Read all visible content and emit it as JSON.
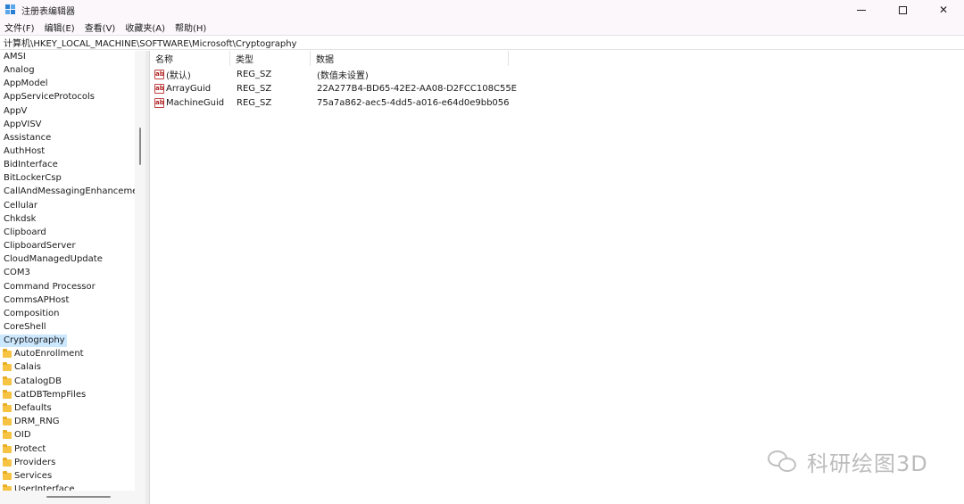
{
  "window": {
    "title": "注册表编辑器",
    "controls": {
      "minimize": "",
      "maximize": "",
      "close": "✕"
    }
  },
  "menu": [
    "文件(F)",
    "编辑(E)",
    "查看(V)",
    "收藏夹(A)",
    "帮助(H)"
  ],
  "address": "计算机\\HKEY_LOCAL_MACHINE\\SOFTWARE\\Microsoft\\Cryptography",
  "tree": {
    "items": [
      {
        "label": "AMSI"
      },
      {
        "label": "Analog"
      },
      {
        "label": "AppModel"
      },
      {
        "label": "AppServiceProtocols"
      },
      {
        "label": "AppV"
      },
      {
        "label": "AppVISV"
      },
      {
        "label": "Assistance"
      },
      {
        "label": "AuthHost"
      },
      {
        "label": "BidInterface"
      },
      {
        "label": "BitLockerCsp"
      },
      {
        "label": "CallAndMessagingEnhancement"
      },
      {
        "label": "Cellular"
      },
      {
        "label": "Chkdsk"
      },
      {
        "label": "Clipboard"
      },
      {
        "label": "ClipboardServer"
      },
      {
        "label": "CloudManagedUpdate"
      },
      {
        "label": "COM3"
      },
      {
        "label": "Command Processor"
      },
      {
        "label": "CommsAPHost"
      },
      {
        "label": "Composition"
      },
      {
        "label": "CoreShell"
      },
      {
        "label": "Cryptography",
        "selected": true
      }
    ],
    "children": [
      {
        "label": "AutoEnrollment"
      },
      {
        "label": "Calais"
      },
      {
        "label": "CatalogDB"
      },
      {
        "label": "CatDBTempFiles"
      },
      {
        "label": "Defaults"
      },
      {
        "label": "DRM_RNG"
      },
      {
        "label": "OID"
      },
      {
        "label": "Protect"
      },
      {
        "label": "Providers"
      },
      {
        "label": "Services"
      },
      {
        "label": "UserInterface"
      }
    ]
  },
  "list": {
    "columns": [
      "名称",
      "类型",
      "数据"
    ],
    "rows": [
      {
        "icon": "ab",
        "name": "(默认)",
        "type": "REG_SZ",
        "data": "(数值未设置)"
      },
      {
        "icon": "ab",
        "name": "ArrayGuid",
        "type": "REG_SZ",
        "data": "22A277B4-BD65-42E2-AA08-D2FCC108C55E"
      },
      {
        "icon": "ab",
        "name": "MachineGuid",
        "type": "REG_SZ",
        "data": "75a7a862-aec5-4dd5-a016-e64d0e9bb056"
      }
    ]
  },
  "watermark": {
    "text": "科研绘图3D"
  }
}
